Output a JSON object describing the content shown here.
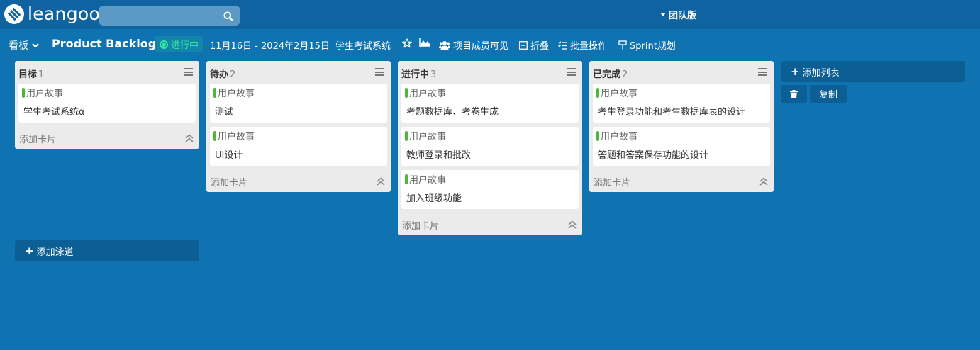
{
  "app": {
    "logo_text": "leangoo",
    "edition_label": "团队版"
  },
  "search": {
    "placeholder": ""
  },
  "toolbar": {
    "board_switch_label": "看板",
    "board_name": "Product Backlog",
    "status_label": "进行中",
    "date_range": "11月16日 - 2024年2月15日",
    "project_name": "学生考试系统",
    "visibility_label": "项目成员可见",
    "collapse_label": "折叠",
    "batch_label": "批量操作",
    "sprint_label": "Sprint规划"
  },
  "lists": [
    {
      "title": "目标",
      "count": "1",
      "add_card_label": "添加卡片",
      "cards": [
        {
          "tag": "用户故事",
          "title": "学生考试系统α"
        }
      ]
    },
    {
      "title": "待办",
      "count": "2",
      "add_card_label": "添加卡片",
      "cards": [
        {
          "tag": "用户故事",
          "title": "测试"
        },
        {
          "tag": "用户故事",
          "title": "UI设计"
        }
      ]
    },
    {
      "title": "进行中",
      "count": "3",
      "add_card_label": "添加卡片",
      "cards": [
        {
          "tag": "用户故事",
          "title": "考题数据库、考卷生成"
        },
        {
          "tag": "用户故事",
          "title": "教师登录和批改"
        },
        {
          "tag": "用户故事",
          "title": "加入班级功能"
        }
      ]
    },
    {
      "title": "已完成",
      "count": "2",
      "add_card_label": "添加卡片",
      "cards": [
        {
          "tag": "用户故事",
          "title": "考生登录功能和考生数据库表的设计"
        },
        {
          "tag": "用户故事",
          "title": "答题和答案保存功能的设计"
        }
      ]
    }
  ],
  "actions": {
    "add_list_label": "添加列表",
    "copy_label": "复制",
    "add_swimlane_label": "添加泳道"
  },
  "colors": {
    "background": "#0f73b1",
    "topbar": "#0e63a0",
    "tag_green": "#4cb833",
    "status_green": "#35e3a4"
  }
}
